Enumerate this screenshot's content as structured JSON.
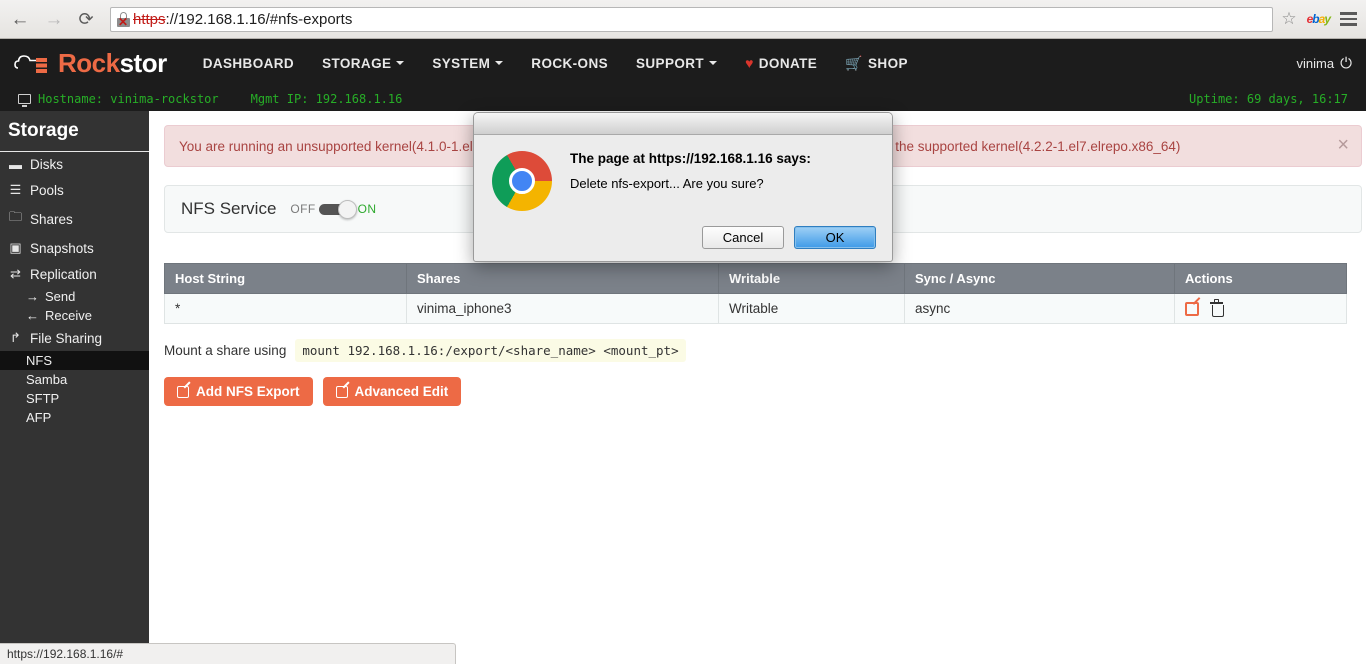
{
  "browser": {
    "back_icon": "←",
    "forward_icon": "→",
    "reload_icon": "⟳",
    "url_scheme": "https",
    "url_rest": "://192.168.1.16/#nfs-exports",
    "star_icon": "☆",
    "ebay_label": "ebay",
    "status_url": "https://192.168.1.16/#"
  },
  "navbar": {
    "brand_rock": "Rock",
    "brand_stor": "stor",
    "links": [
      {
        "label": "DASHBOARD",
        "caret": false
      },
      {
        "label": "STORAGE",
        "caret": true
      },
      {
        "label": "SYSTEM",
        "caret": true
      },
      {
        "label": "ROCK-ONS",
        "caret": false
      },
      {
        "label": "SUPPORT",
        "caret": true
      }
    ],
    "donate_label": "DONATE",
    "donate_icon": "♥",
    "shop_label": "SHOP",
    "shop_icon": "🛒",
    "user": "vinima",
    "power_icon": "⏻"
  },
  "status_strip": {
    "hostname": "Hostname: vinima-rockstor",
    "mgmt_ip": "Mgmt IP: 192.168.1.16",
    "uptime": "Uptime: 69 days, 16:17"
  },
  "sidebar": {
    "title": "Storage",
    "items": [
      {
        "label": "Disks",
        "icon": "disk-icon",
        "glyph": "▭"
      },
      {
        "label": "Pools",
        "icon": "list-icon",
        "glyph": "☰"
      },
      {
        "label": "Shares",
        "icon": "folder-icon",
        "glyph": "📁"
      },
      {
        "label": "Snapshots",
        "icon": "camera-icon",
        "glyph": "📷"
      },
      {
        "label": "Replication",
        "icon": "exchange-icon",
        "glyph": "⇄"
      }
    ],
    "replication_subs": [
      {
        "label": "Send",
        "arrow": "→"
      },
      {
        "label": "Receive",
        "arrow": "←"
      }
    ],
    "file_sharing": {
      "label": "File Sharing",
      "icon": "share-icon",
      "glyph": "↱"
    },
    "file_sharing_subs": [
      {
        "label": "NFS",
        "active": true
      },
      {
        "label": "Samba",
        "active": false
      },
      {
        "label": "SFTP",
        "active": false
      },
      {
        "label": "AFP",
        "active": false
      }
    ]
  },
  "alert": {
    "text": "You are running an unsupported kernel(4.1.0-1.el7.elrepo.x86_64). Reboot and the system will automatically boot using the supported kernel(4.2.2-1.el7.elrepo.x86_64)",
    "close_icon": "×"
  },
  "service": {
    "title": "NFS Service",
    "off_label": "OFF",
    "on_label": "ON",
    "state": "ON"
  },
  "table": {
    "columns": [
      "Host String",
      "Shares",
      "Writable",
      "Sync / Async",
      "Actions"
    ],
    "rows": [
      {
        "host_string": "*",
        "shares": "vinima_iphone3",
        "writable": "Writable",
        "sync_async": "async",
        "actions": [
          "edit-icon",
          "trash-icon"
        ]
      }
    ]
  },
  "mount": {
    "label": "Mount a share using",
    "command": "mount 192.168.1.16:/export/<share_name> <mount_pt>"
  },
  "buttons": [
    {
      "label": "Add NFS Export"
    },
    {
      "label": "Advanced Edit"
    }
  ],
  "modal": {
    "title": "The page at https://192.168.1.16 says:",
    "message": "Delete nfs-export... Are you sure?",
    "cancel_label": "Cancel",
    "ok_label": "OK"
  },
  "colors": {
    "brand_orange": "#ed6a45",
    "navbar_dark": "#1c1c1c",
    "sidebar_dark": "#333333",
    "terminal_green": "#27ae27",
    "alert_bg": "#f2dede",
    "alert_text": "#a94442",
    "table_header": "#7b8189",
    "primary_blue": "#3e9ae8"
  }
}
